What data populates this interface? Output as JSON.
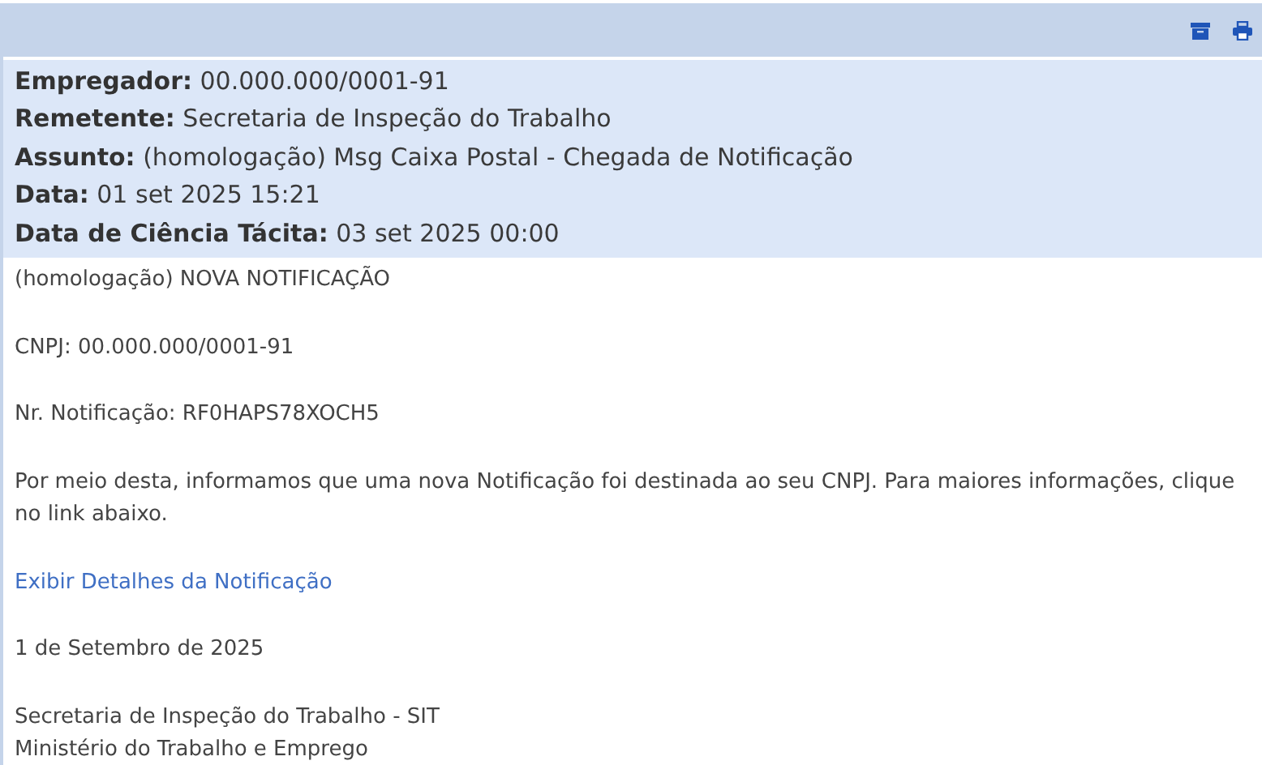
{
  "toolbar": {
    "buttons": [
      {
        "kind": "archive"
      },
      {
        "kind": "print"
      }
    ]
  },
  "header": [
    {
      "label": "Empregador:",
      "value": "00.000.000/0001-91"
    },
    {
      "label": "Remetente:",
      "value": "Secretaria de Inspeção do Trabalho"
    },
    {
      "label": "Assunto:",
      "value": "(homologação) Msg Caixa Postal - Chegada de Notificação"
    },
    {
      "label": "Data:",
      "value": "01 set 2025 15:21"
    },
    {
      "label": "Data de Ciência Tácita:",
      "value": "03 set 2025 00:00"
    }
  ],
  "body": [
    {
      "kind": "text",
      "lines": [
        "(homologação) NOVA NOTIFICAÇÃO"
      ]
    },
    {
      "kind": "text",
      "lines": [
        "CNPJ: 00.000.000/0001-91"
      ]
    },
    {
      "kind": "text",
      "lines": [
        "Nr. Notificação: RF0HAPS78XOCH5"
      ]
    },
    {
      "kind": "text",
      "lines": [
        "Por meio desta, informamos que uma nova Notificação foi destinada ao seu CNPJ. Para maiores informações, clique no link abaixo."
      ]
    },
    {
      "kind": "link",
      "lines": [
        "Exibir Detalhes da Notificação"
      ]
    },
    {
      "kind": "text",
      "lines": [
        "1 de Setembro de 2025"
      ]
    },
    {
      "kind": "text",
      "lines": [
        "Secretaria de Inspeção do Trabalho - SIT",
        "Ministério do Trabalho e Emprego"
      ]
    }
  ]
}
